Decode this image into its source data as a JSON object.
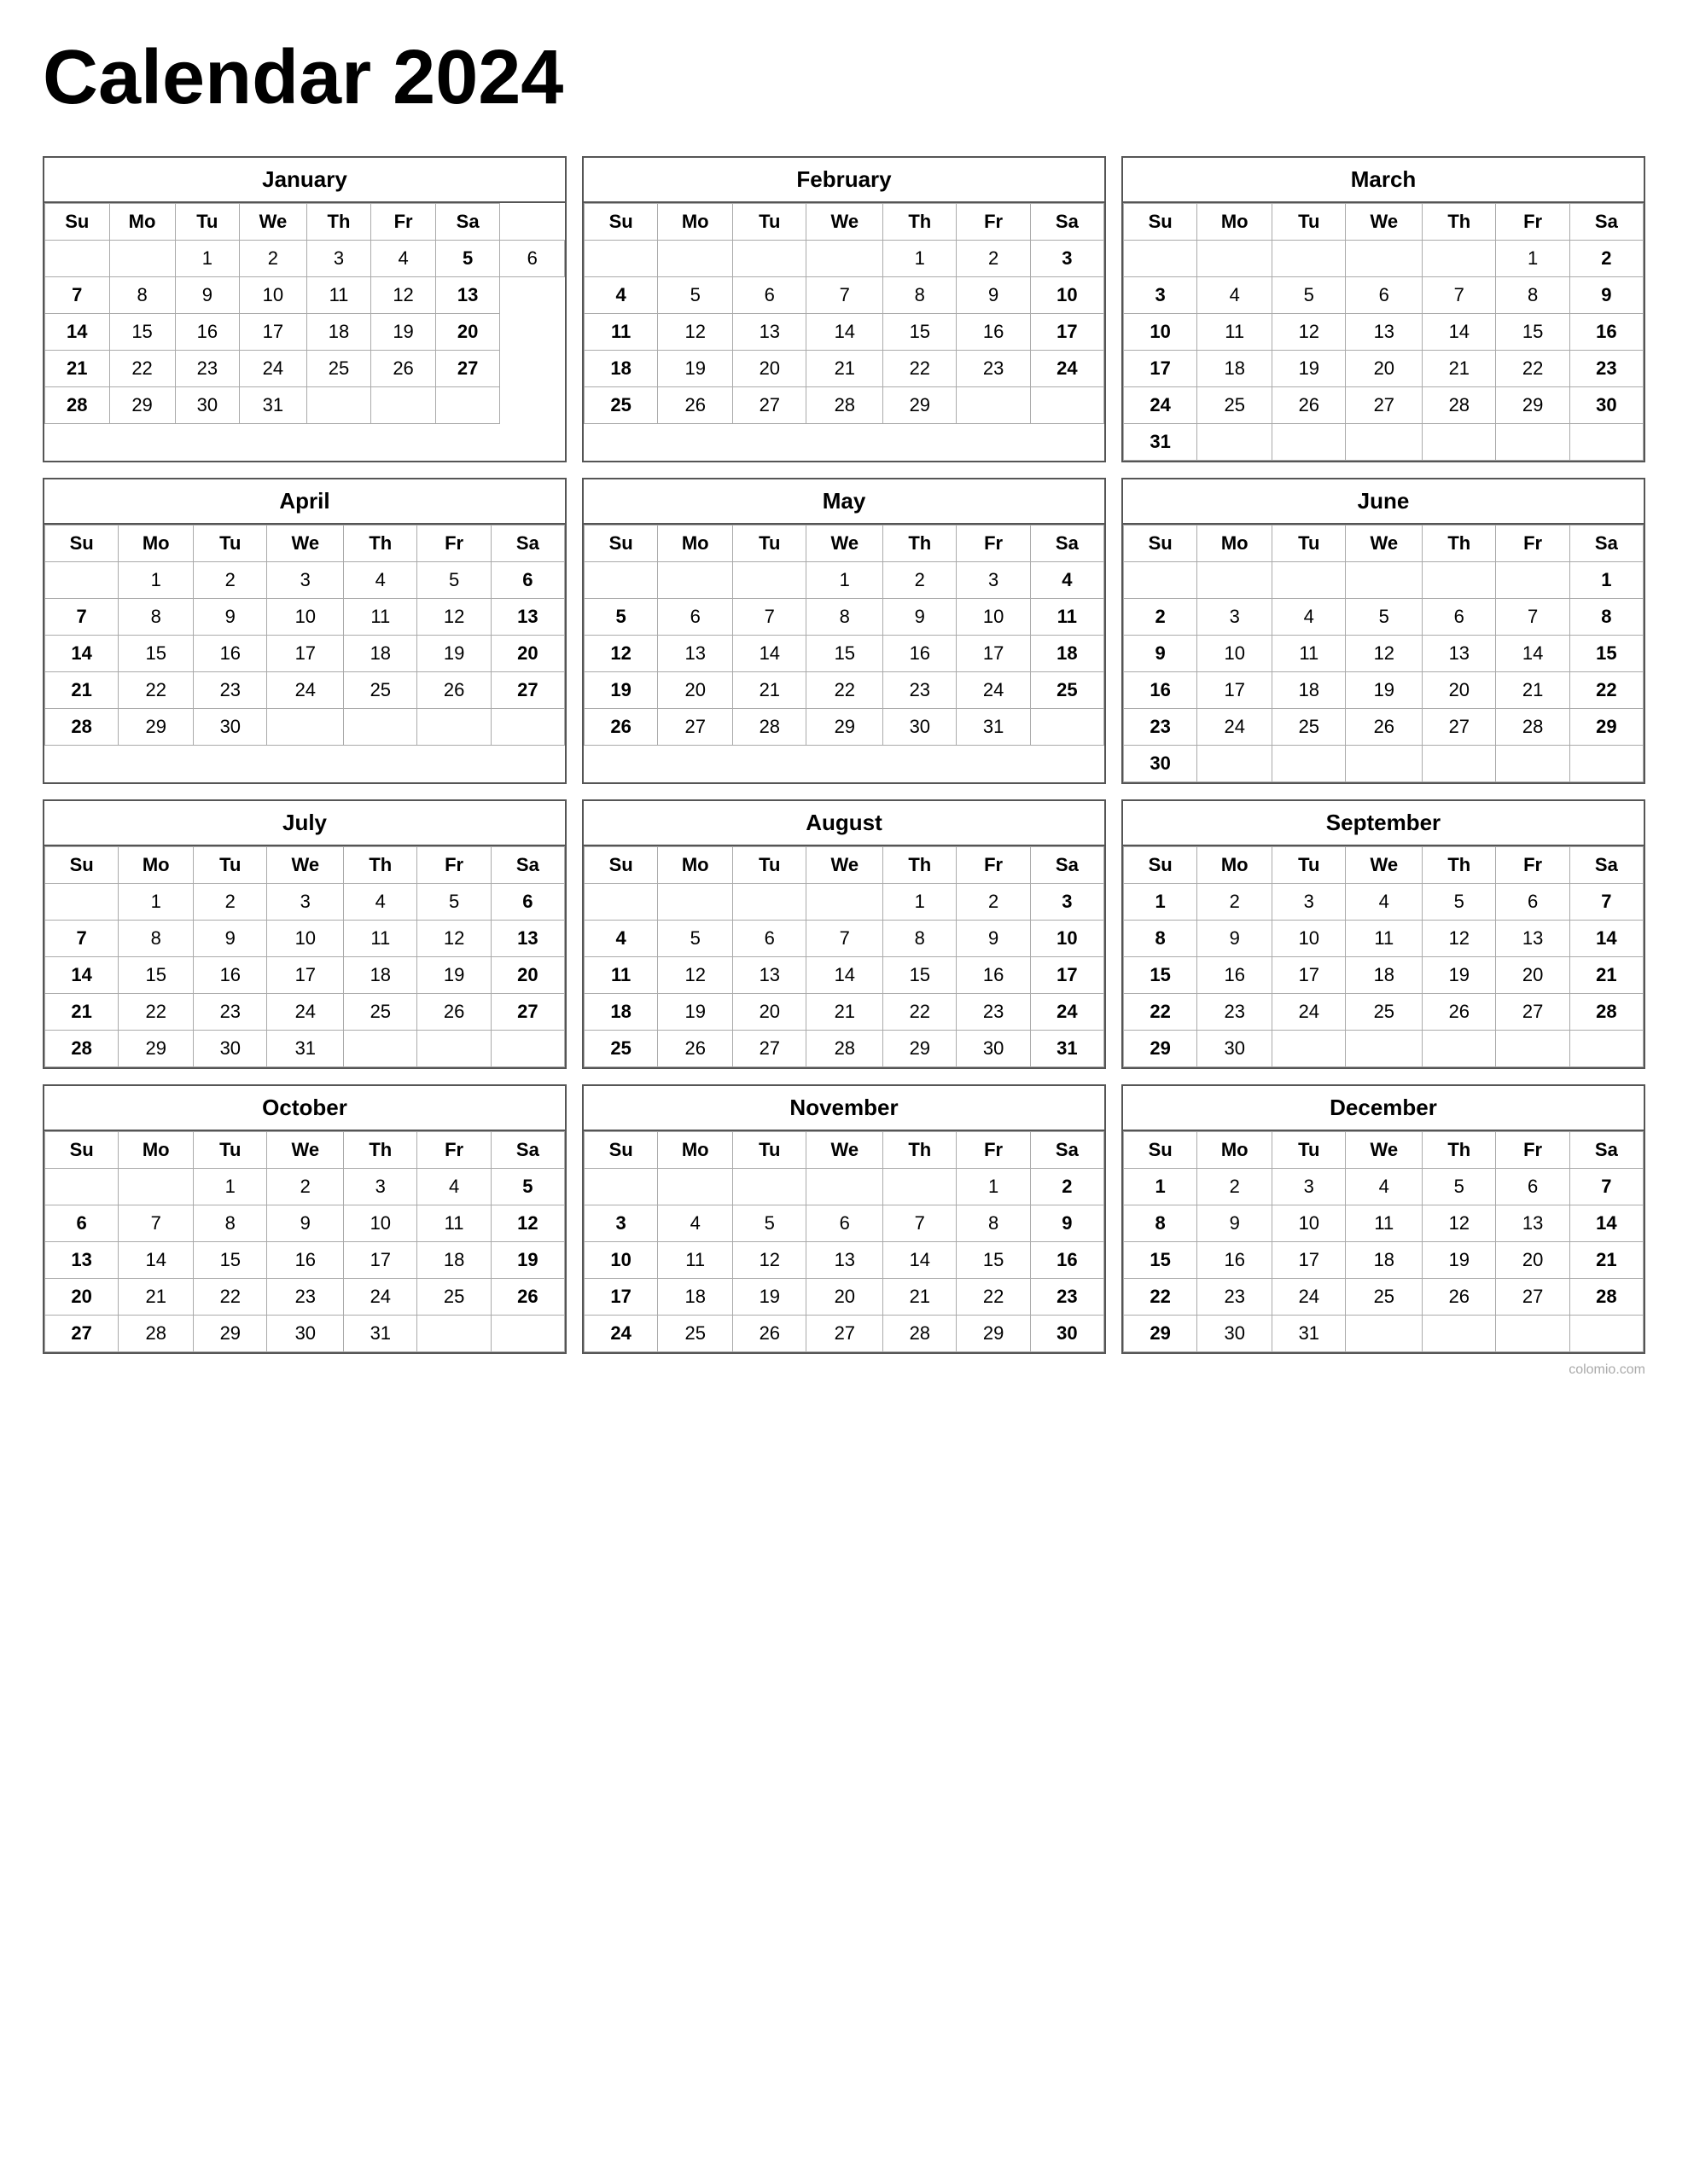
{
  "title": "Calendar 2024",
  "months": [
    {
      "name": "January",
      "weeks": [
        [
          "",
          "",
          "1",
          "2",
          "3",
          "4",
          "5",
          "6"
        ],
        [
          "7",
          "8",
          "9",
          "10",
          "11",
          "12",
          "13"
        ],
        [
          "14",
          "15",
          "16",
          "17",
          "18",
          "19",
          "20"
        ],
        [
          "21",
          "22",
          "23",
          "24",
          "25",
          "26",
          "27"
        ],
        [
          "28",
          "29",
          "30",
          "31",
          "",
          "",
          ""
        ]
      ]
    },
    {
      "name": "February",
      "weeks": [
        [
          "",
          "",
          "",
          "",
          "1",
          "2",
          "3"
        ],
        [
          "4",
          "5",
          "6",
          "7",
          "8",
          "9",
          "10"
        ],
        [
          "11",
          "12",
          "13",
          "14",
          "15",
          "16",
          "17"
        ],
        [
          "18",
          "19",
          "20",
          "21",
          "22",
          "23",
          "24"
        ],
        [
          "25",
          "26",
          "27",
          "28",
          "29",
          "",
          ""
        ]
      ]
    },
    {
      "name": "March",
      "weeks": [
        [
          "",
          "",
          "",
          "",
          "",
          "1",
          "2"
        ],
        [
          "3",
          "4",
          "5",
          "6",
          "7",
          "8",
          "9"
        ],
        [
          "10",
          "11",
          "12",
          "13",
          "14",
          "15",
          "16"
        ],
        [
          "17",
          "18",
          "19",
          "20",
          "21",
          "22",
          "23"
        ],
        [
          "24",
          "25",
          "26",
          "27",
          "28",
          "29",
          "30"
        ],
        [
          "31",
          "",
          "",
          "",
          "",
          "",
          ""
        ]
      ]
    },
    {
      "name": "April",
      "weeks": [
        [
          "",
          "1",
          "2",
          "3",
          "4",
          "5",
          "6"
        ],
        [
          "7",
          "8",
          "9",
          "10",
          "11",
          "12",
          "13"
        ],
        [
          "14",
          "15",
          "16",
          "17",
          "18",
          "19",
          "20"
        ],
        [
          "21",
          "22",
          "23",
          "24",
          "25",
          "26",
          "27"
        ],
        [
          "28",
          "29",
          "30",
          "",
          "",
          "",
          ""
        ]
      ]
    },
    {
      "name": "May",
      "weeks": [
        [
          "",
          "",
          "",
          "1",
          "2",
          "3",
          "4"
        ],
        [
          "5",
          "6",
          "7",
          "8",
          "9",
          "10",
          "11"
        ],
        [
          "12",
          "13",
          "14",
          "15",
          "16",
          "17",
          "18"
        ],
        [
          "19",
          "20",
          "21",
          "22",
          "23",
          "24",
          "25"
        ],
        [
          "26",
          "27",
          "28",
          "29",
          "30",
          "31",
          ""
        ]
      ]
    },
    {
      "name": "June",
      "weeks": [
        [
          "",
          "",
          "",
          "",
          "",
          "",
          "1"
        ],
        [
          "2",
          "3",
          "4",
          "5",
          "6",
          "7",
          "8"
        ],
        [
          "9",
          "10",
          "11",
          "12",
          "13",
          "14",
          "15"
        ],
        [
          "16",
          "17",
          "18",
          "19",
          "20",
          "21",
          "22"
        ],
        [
          "23",
          "24",
          "25",
          "26",
          "27",
          "28",
          "29"
        ],
        [
          "30",
          "",
          "",
          "",
          "",
          "",
          ""
        ]
      ]
    },
    {
      "name": "July",
      "weeks": [
        [
          "",
          "1",
          "2",
          "3",
          "4",
          "5",
          "6"
        ],
        [
          "7",
          "8",
          "9",
          "10",
          "11",
          "12",
          "13"
        ],
        [
          "14",
          "15",
          "16",
          "17",
          "18",
          "19",
          "20"
        ],
        [
          "21",
          "22",
          "23",
          "24",
          "25",
          "26",
          "27"
        ],
        [
          "28",
          "29",
          "30",
          "31",
          "",
          "",
          ""
        ]
      ]
    },
    {
      "name": "August",
      "weeks": [
        [
          "",
          "",
          "",
          "",
          "1",
          "2",
          "3"
        ],
        [
          "4",
          "5",
          "6",
          "7",
          "8",
          "9",
          "10"
        ],
        [
          "11",
          "12",
          "13",
          "14",
          "15",
          "16",
          "17"
        ],
        [
          "18",
          "19",
          "20",
          "21",
          "22",
          "23",
          "24"
        ],
        [
          "25",
          "26",
          "27",
          "28",
          "29",
          "30",
          "31"
        ]
      ]
    },
    {
      "name": "September",
      "weeks": [
        [
          "1",
          "2",
          "3",
          "4",
          "5",
          "6",
          "7"
        ],
        [
          "8",
          "9",
          "10",
          "11",
          "12",
          "13",
          "14"
        ],
        [
          "15",
          "16",
          "17",
          "18",
          "19",
          "20",
          "21"
        ],
        [
          "22",
          "23",
          "24",
          "25",
          "26",
          "27",
          "28"
        ],
        [
          "29",
          "30",
          "",
          "",
          "",
          "",
          ""
        ]
      ]
    },
    {
      "name": "October",
      "weeks": [
        [
          "",
          "",
          "1",
          "2",
          "3",
          "4",
          "5"
        ],
        [
          "6",
          "7",
          "8",
          "9",
          "10",
          "11",
          "12"
        ],
        [
          "13",
          "14",
          "15",
          "16",
          "17",
          "18",
          "19"
        ],
        [
          "20",
          "21",
          "22",
          "23",
          "24",
          "25",
          "26"
        ],
        [
          "27",
          "28",
          "29",
          "30",
          "31",
          "",
          ""
        ]
      ]
    },
    {
      "name": "November",
      "weeks": [
        [
          "",
          "",
          "",
          "",
          "",
          "1",
          "2"
        ],
        [
          "3",
          "4",
          "5",
          "6",
          "7",
          "8",
          "9"
        ],
        [
          "10",
          "11",
          "12",
          "13",
          "14",
          "15",
          "16"
        ],
        [
          "17",
          "18",
          "19",
          "20",
          "21",
          "22",
          "23"
        ],
        [
          "24",
          "25",
          "26",
          "27",
          "28",
          "29",
          "30"
        ]
      ]
    },
    {
      "name": "December",
      "weeks": [
        [
          "1",
          "2",
          "3",
          "4",
          "5",
          "6",
          "7"
        ],
        [
          "8",
          "9",
          "10",
          "11",
          "12",
          "13",
          "14"
        ],
        [
          "15",
          "16",
          "17",
          "18",
          "19",
          "20",
          "21"
        ],
        [
          "22",
          "23",
          "24",
          "25",
          "26",
          "27",
          "28"
        ],
        [
          "29",
          "30",
          "31",
          "",
          "",
          "",
          ""
        ]
      ]
    }
  ],
  "days": [
    "Su",
    "Mo",
    "Tu",
    "We",
    "Th",
    "Fr",
    "Sa"
  ],
  "watermark": "colomio.com"
}
